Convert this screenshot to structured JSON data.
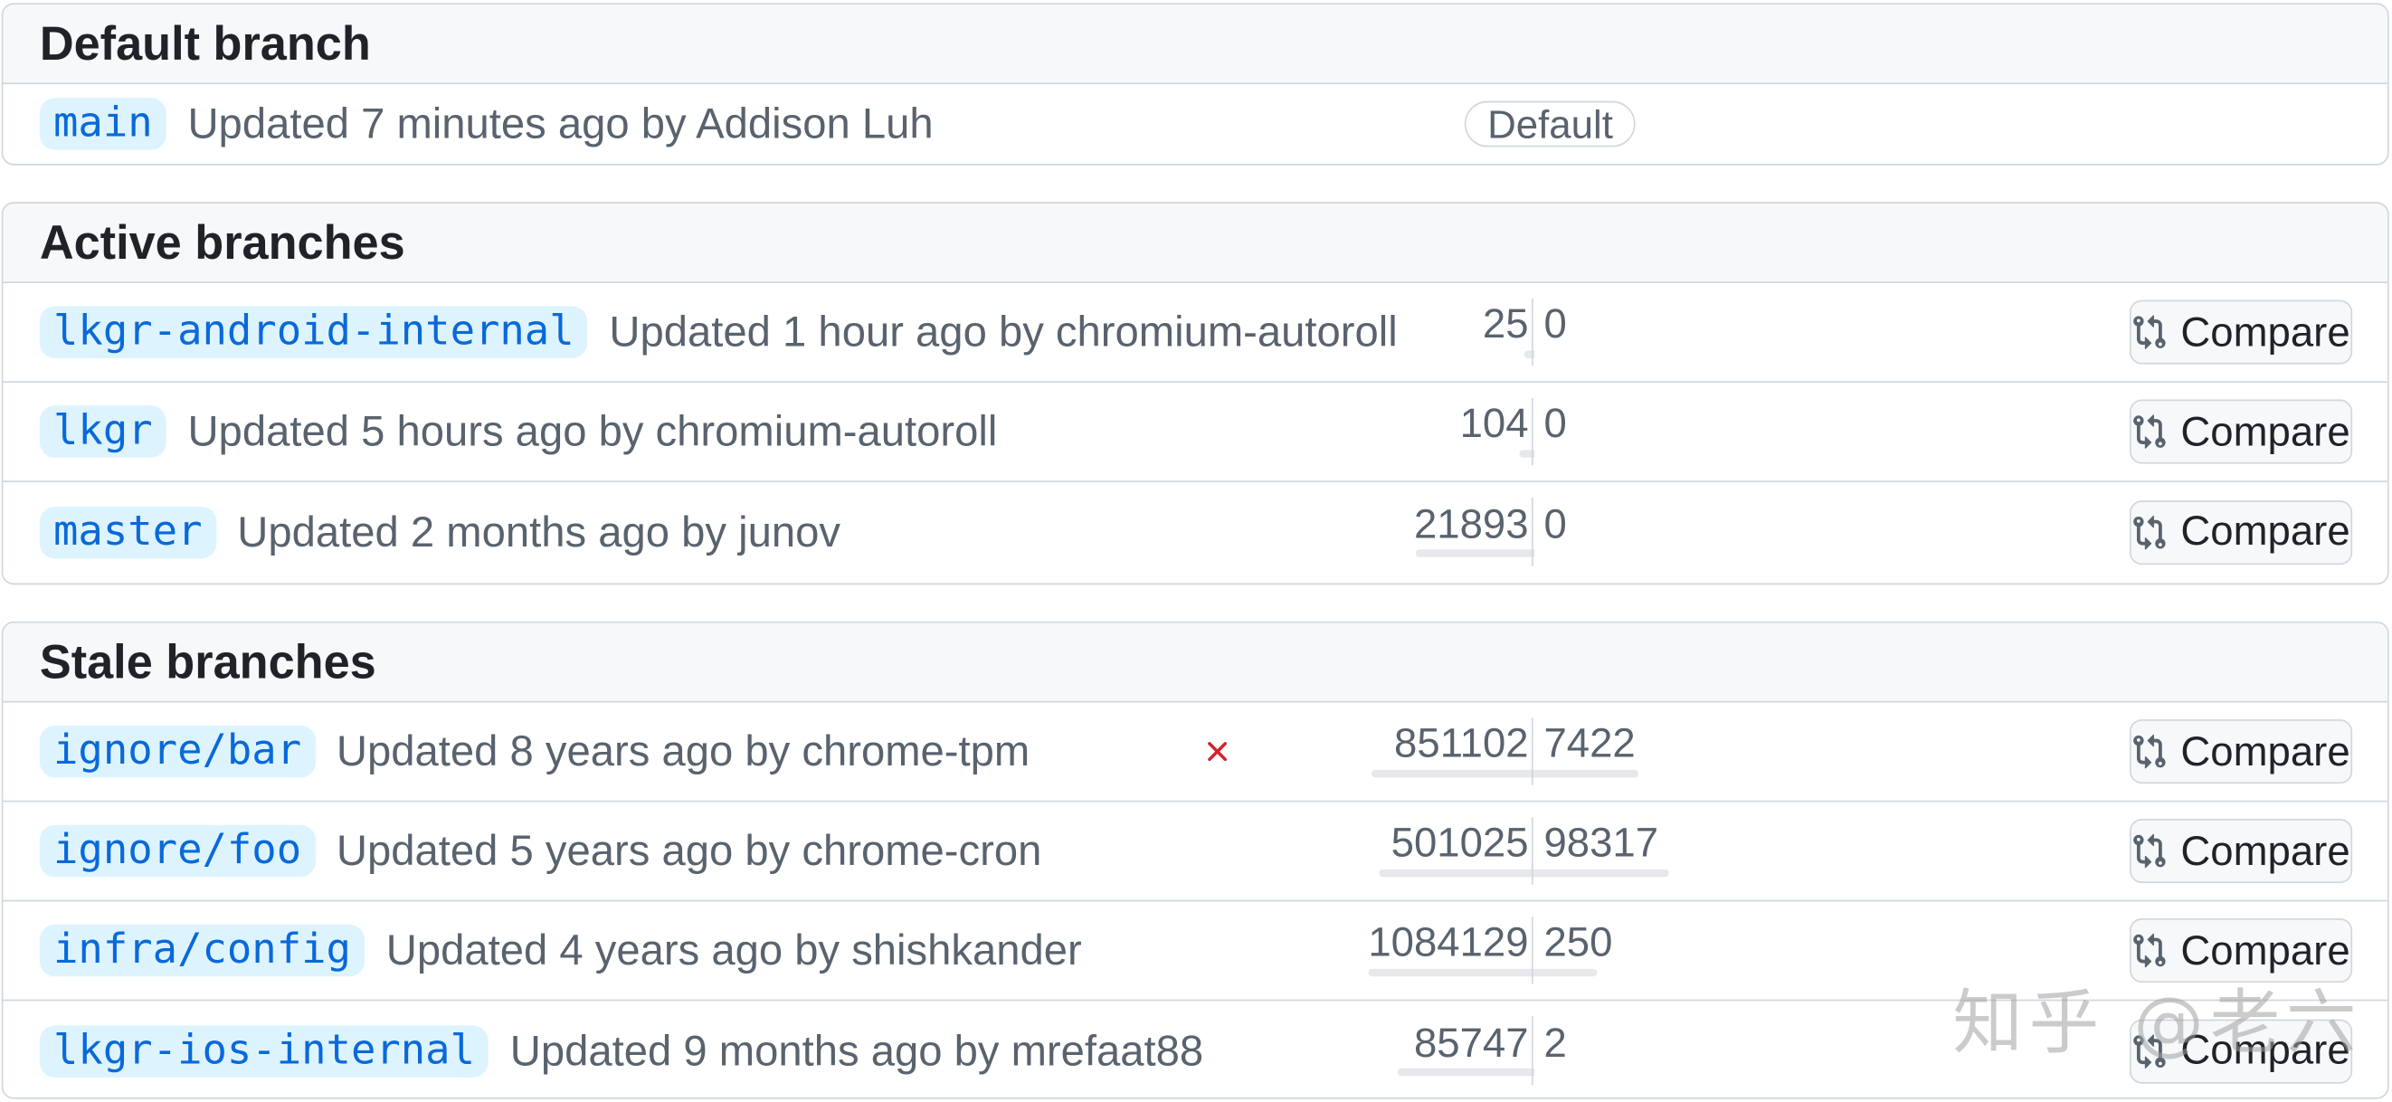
{
  "sections": {
    "default": {
      "title": "Default branch"
    },
    "active": {
      "title": "Active branches"
    },
    "stale": {
      "title": "Stale branches"
    }
  },
  "default_branch": {
    "name": "main",
    "description": "Updated 7 minutes ago by Addison Luh",
    "label": "Default"
  },
  "active_branches": [
    {
      "name": "lkgr-android-internal",
      "description": "Updated 1 hour ago by chromium-autoroll",
      "behind": "25",
      "ahead": "0",
      "behind_fraction": 0.04,
      "ahead_fraction": 0.0
    },
    {
      "name": "lkgr",
      "description": "Updated 5 hours ago by chromium-autoroll",
      "behind": "104",
      "ahead": "0",
      "behind_fraction": 0.06,
      "ahead_fraction": 0.0
    },
    {
      "name": "master",
      "description": "Updated 2 months ago by junov",
      "behind": "21893",
      "ahead": "0",
      "behind_fraction": 0.46,
      "ahead_fraction": 0.0
    }
  ],
  "stale_branches": [
    {
      "name": "ignore/bar",
      "description": "Updated 8 years ago by chrome-tpm",
      "behind": "851102",
      "ahead": "7422",
      "behind_fraction": 0.63,
      "ahead_fraction": 0.4,
      "status": "failure"
    },
    {
      "name": "ignore/foo",
      "description": "Updated 5 years ago by chrome-cron",
      "behind": "501025",
      "ahead": "98317",
      "behind_fraction": 0.6,
      "ahead_fraction": 0.52
    },
    {
      "name": "infra/config",
      "description": "Updated 4 years ago by shishkander",
      "behind": "1084129",
      "ahead": "250",
      "behind_fraction": 0.64,
      "ahead_fraction": 0.24
    },
    {
      "name": "lkgr-ios-internal",
      "description": "Updated 9 months ago by mrefaat88",
      "behind": "85747",
      "ahead": "2",
      "behind_fraction": 0.53,
      "ahead_fraction": 0.0
    }
  ],
  "compare_label": "Compare",
  "watermark": "知乎 @老六",
  "colors": {
    "link": "#0969da",
    "branch_bg": "#ddf4ff",
    "border": "#d0d7de",
    "fail": "#cf222e"
  },
  "icons": {
    "compare": "git-compare-icon",
    "status": "x-icon"
  }
}
